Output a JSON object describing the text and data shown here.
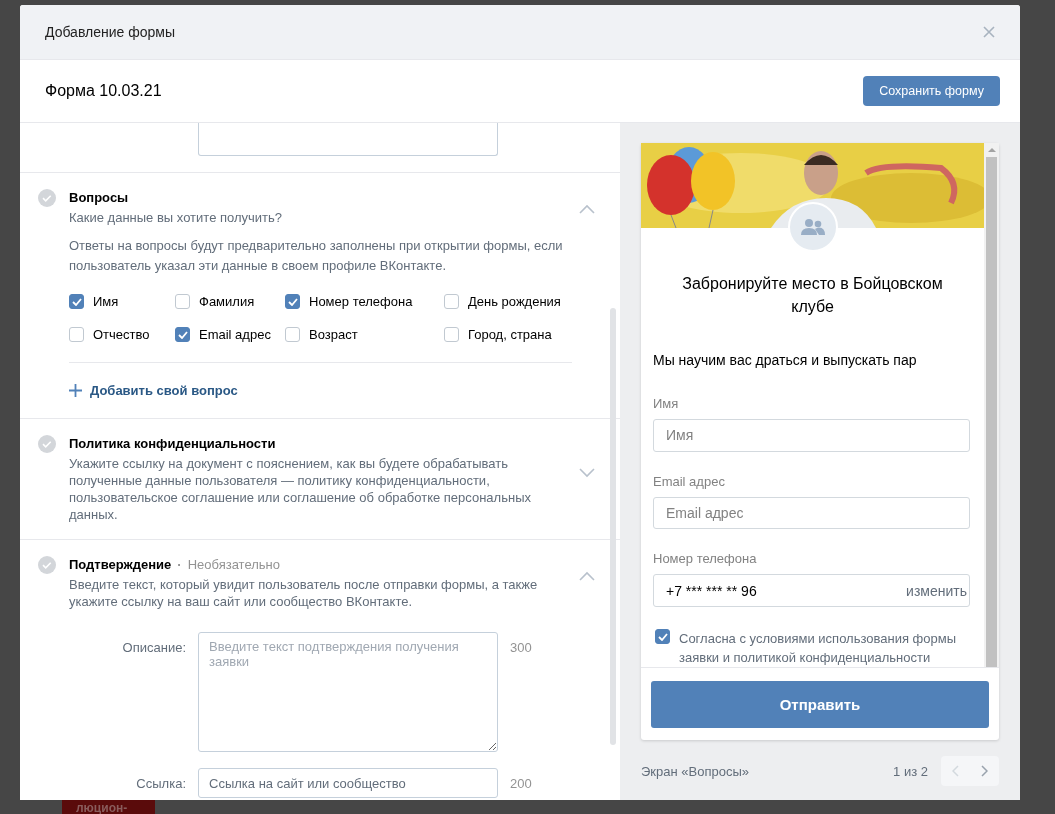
{
  "modal": {
    "title": "Добавление формы"
  },
  "form_header": {
    "name": "Форма 10.03.21",
    "save_button": "Сохранить форму"
  },
  "sections": [
    {
      "kind": "questions",
      "title": "Вопросы",
      "subtitle": "Какие данные вы хотите получить?",
      "note": "Ответы на вопросы будут предварительно заполнены при открытии формы, если пользователь указал эти данные в своем профиле ВКонтакте.",
      "expanded": true,
      "checkboxes": [
        {
          "label": "Имя",
          "checked": true
        },
        {
          "label": "Фамилия",
          "checked": false
        },
        {
          "label": "Номер телефона",
          "checked": true
        },
        {
          "label": "День рождения",
          "checked": false
        },
        {
          "label": "Отчество",
          "checked": false
        },
        {
          "label": "Email адрес",
          "checked": true
        },
        {
          "label": "Возраст",
          "checked": false
        },
        {
          "label": "Город, страна",
          "checked": false
        }
      ],
      "add_link": "Добавить свой вопрос"
    },
    {
      "kind": "text",
      "title": "Политика конфиденциальности",
      "description": "Укажите ссылку на документ с пояснением, как вы будете обрабатывать полученные данные пользователя — политику конфиденциальности, пользовательское соглашение или соглашение об обработке персональных данных.",
      "expanded": false
    },
    {
      "kind": "fields",
      "title": "Подтверждение",
      "separator": "·",
      "optional": "Необязательно",
      "description": "Введите текст, который увидит пользователь после отправки формы, а также укажите ссылку на ваш сайт или сообщество ВКонтакте.",
      "expanded": true,
      "fields": [
        {
          "label": "Описание:",
          "placeholder": "Введите текст подтверждения получения заявки",
          "counter": "300",
          "kind": "textarea"
        },
        {
          "label": "Ссылка:",
          "placeholder": "Ссылка на сайт или сообщество",
          "counter": "200",
          "kind": "input"
        }
      ]
    }
  ],
  "preview": {
    "title": "Забронируйте место в Бойцовском клубе",
    "description": "Мы научим вас драться и выпускать пар",
    "fields": [
      {
        "label": "Имя",
        "placeholder": "Имя"
      },
      {
        "label": "Email адрес",
        "placeholder": "Email адрес"
      },
      {
        "label": "Номер телефона",
        "value": "+7 *** *** ** 96",
        "action": "изменить"
      }
    ],
    "consent": {
      "text": "Согласна с условиями использования формы заявки и политикой конфиденциальности",
      "checked": true
    },
    "submit": "Отправить"
  },
  "preview_footer": {
    "screen": "Экран «Вопросы»",
    "page": "1 из 2"
  },
  "backdrop": {
    "tile_text": "люцион-"
  }
}
